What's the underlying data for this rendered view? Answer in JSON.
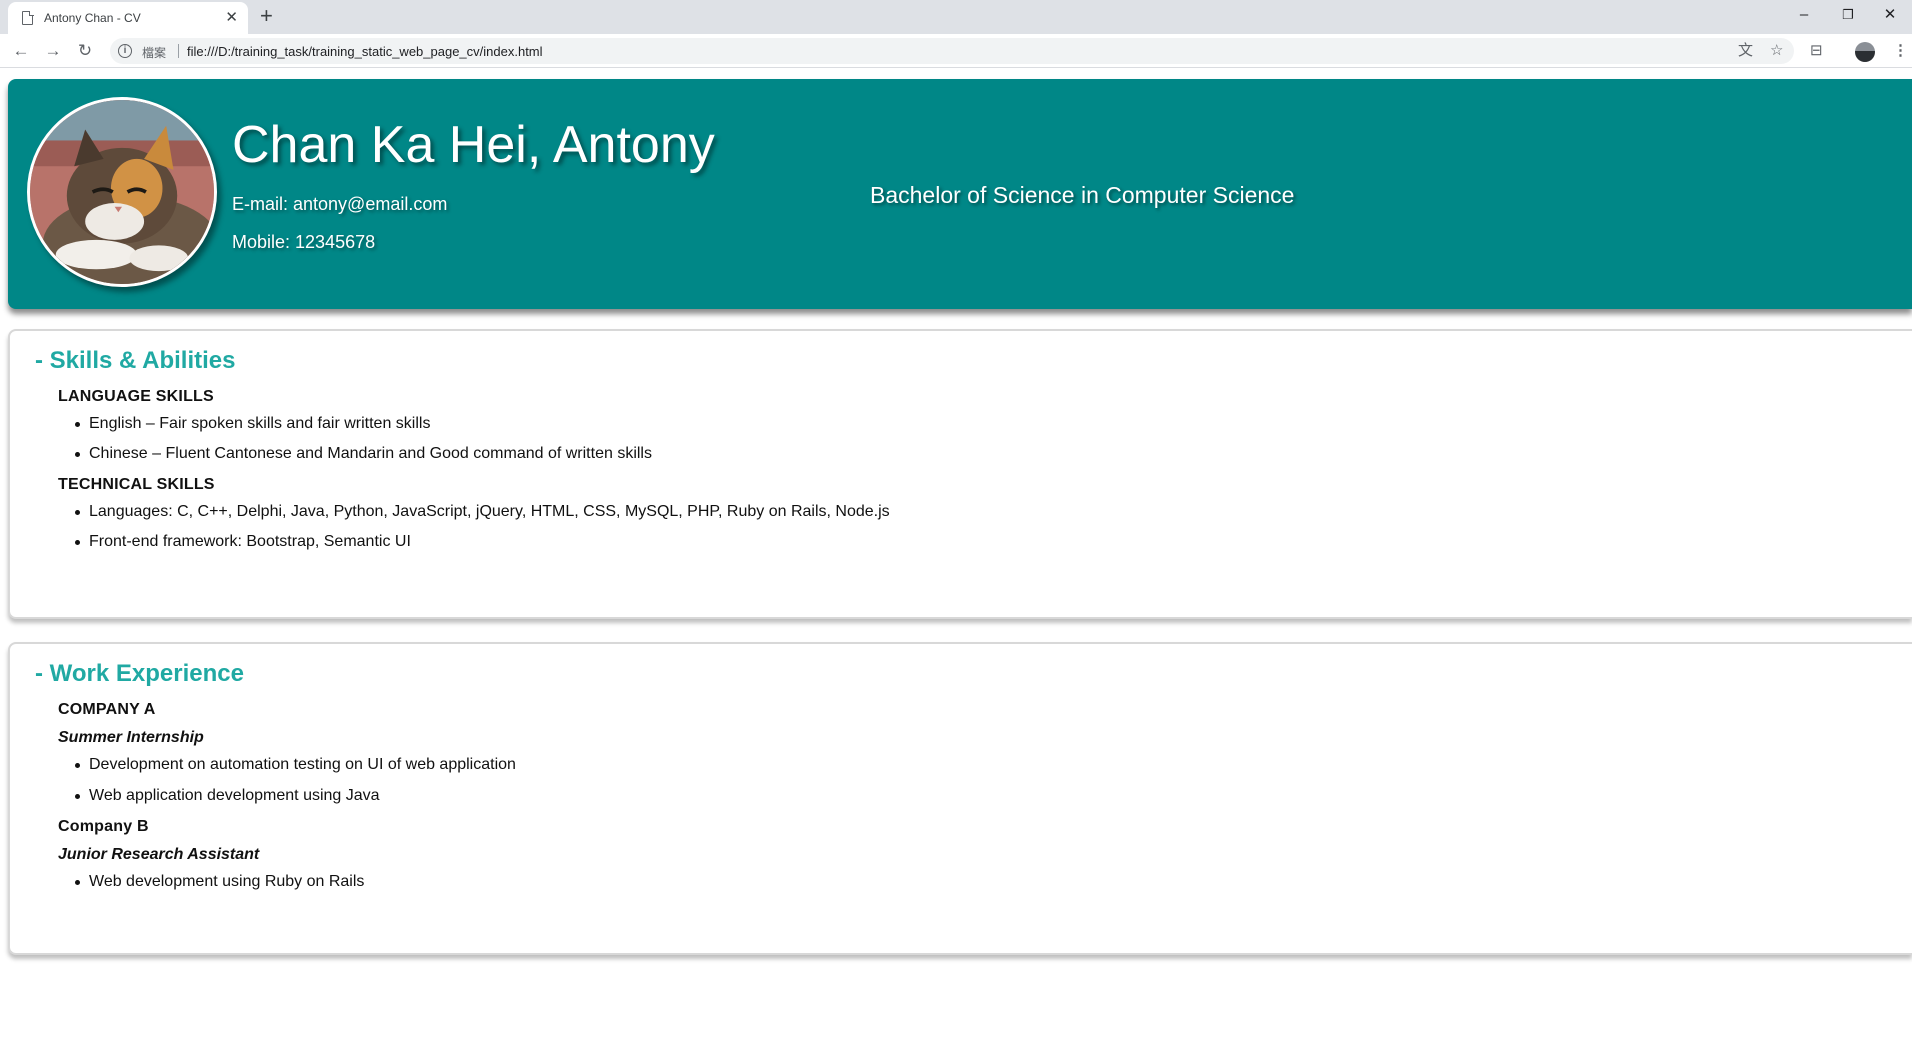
{
  "browser": {
    "tab_title": "Antony Chan - CV",
    "site_label": "檔案",
    "url": "file:///D:/training_task/training_static_web_page_cv/index.html"
  },
  "header": {
    "name": "Chan Ka Hei, Antony",
    "email": "E-mail: antony@email.com",
    "mobile": "Mobile: 12345678",
    "degree": "Bachelor of Science in Computer Science"
  },
  "skills": {
    "title": "- Skills & Abilities",
    "language_heading": "LANGUAGE SKILLS",
    "language_items": [
      "English – Fair spoken skills and fair written skills",
      "Chinese – Fluent Cantonese and Mandarin and Good command of written skills"
    ],
    "technical_heading": "TECHNICAL SKILLS",
    "technical_items": [
      "Languages: C, C++, Delphi, Java, Python, JavaScript, jQuery, HTML, CSS, MySQL, PHP, Ruby on Rails, Node.js",
      "Front-end framework: Bootstrap, Semantic UI"
    ]
  },
  "work": {
    "title": "- Work Experience",
    "companies": [
      {
        "name": "COMPANY A",
        "role": "Summer Internship",
        "items": [
          "Development on automation testing on UI of web application",
          "Web application development using Java"
        ]
      },
      {
        "name": "Company B",
        "role": "Junior Research Assistant",
        "items": [
          "Web development using Ruby on Rails"
        ]
      }
    ]
  }
}
